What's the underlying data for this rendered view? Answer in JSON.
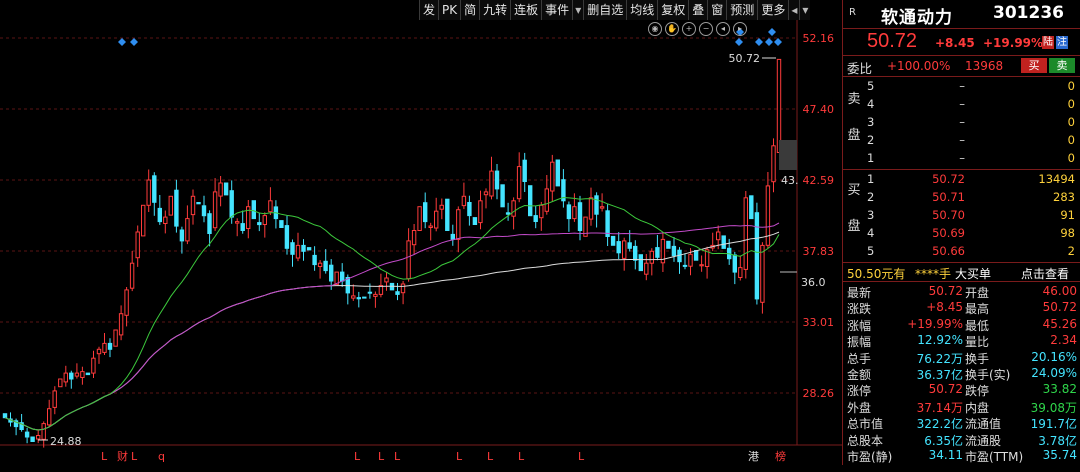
{
  "toolbar": {
    "items": [
      "发",
      "PK",
      "简",
      "九转",
      "连板",
      "事件",
      "▾",
      "删自选",
      "均线",
      "复权",
      "叠",
      "窗",
      "预测",
      "更多",
      "◂",
      "▾"
    ]
  },
  "chart": {
    "price_axis": [
      "52.16",
      "47.40",
      "42.59",
      "37.83",
      "33.01",
      "28.26"
    ],
    "high_label": "50.72",
    "low_label": "24.88",
    "right_tag_1": "43.",
    "right_tag_2": "36.0",
    "bottom_markers": [
      {
        "text": "L",
        "color": "#ff3b3b"
      },
      {
        "text": "财",
        "color": "#ff3b3b"
      },
      {
        "text": "L",
        "color": "#ff3b3b"
      },
      {
        "text": "q",
        "color": "#ff3b3b"
      },
      {
        "text": "L",
        "color": "#ff3b3b"
      },
      {
        "text": "L",
        "color": "#ff3b3b"
      },
      {
        "text": "L",
        "color": "#ff3b3b"
      },
      {
        "text": "L",
        "color": "#ff3b3b"
      },
      {
        "text": "L",
        "color": "#ff3b3b"
      },
      {
        "text": "L",
        "color": "#ff3b3b"
      },
      {
        "text": "L",
        "color": "#ff3b3b"
      },
      {
        "text": "港",
        "color": "#dddddd"
      },
      {
        "text": "榜",
        "color": "#ff3b3b"
      }
    ],
    "colors": {
      "up": "#ff3b3b",
      "down": "#44e4ff",
      "ma_green": "#3cc93c",
      "ma_purple": "#c24bc9",
      "ma_white": "#dcdcdc"
    }
  },
  "stock": {
    "badge": "R",
    "name": "软通动力",
    "code": "301236",
    "price": "50.72",
    "change": "+8.45",
    "change_pct": "+19.99%",
    "tag1": "陆",
    "tag2": "注"
  },
  "weibi": {
    "label": "委比",
    "pct": "+100.00%",
    "num": "13968",
    "buy": "买",
    "sell": "卖"
  },
  "sell_book": {
    "side_label": "卖盘",
    "levels": [
      {
        "lvl": "5",
        "price": "–",
        "vol": "0"
      },
      {
        "lvl": "4",
        "price": "–",
        "vol": "0"
      },
      {
        "lvl": "3",
        "price": "–",
        "vol": "0"
      },
      {
        "lvl": "2",
        "price": "–",
        "vol": "0"
      },
      {
        "lvl": "1",
        "price": "–",
        "vol": "0"
      }
    ]
  },
  "buy_book": {
    "side_label": "买盘",
    "levels": [
      {
        "lvl": "1",
        "price": "50.72",
        "vol": "13494"
      },
      {
        "lvl": "2",
        "price": "50.71",
        "vol": "283"
      },
      {
        "lvl": "3",
        "price": "50.70",
        "vol": "91"
      },
      {
        "lvl": "4",
        "price": "50.69",
        "vol": "98"
      },
      {
        "lvl": "5",
        "price": "50.66",
        "vol": "2"
      }
    ]
  },
  "bigorder": {
    "price": "50.50元有",
    "shares": "****手",
    "big": "大买单",
    "click": "点击查看"
  },
  "stats": [
    {
      "l1": "最新",
      "v1": "50.72",
      "c1": "red",
      "l2": "开盘",
      "v2": "46.00",
      "c2": "red"
    },
    {
      "l1": "涨跌",
      "v1": "+8.45",
      "c1": "red",
      "l2": "最高",
      "v2": "50.72",
      "c2": "red"
    },
    {
      "l1": "涨幅",
      "v1": "+19.99%",
      "c1": "red",
      "l2": "最低",
      "v2": "45.26",
      "c2": "red"
    },
    {
      "l1": "振幅",
      "v1": "12.92%",
      "c1": "cyan",
      "l2": "量比",
      "v2": "2.34",
      "c2": "red"
    },
    {
      "l1": "总手",
      "v1": "76.22万",
      "c1": "cyan",
      "l2": "换手",
      "v2": "20.16%",
      "c2": "cyan"
    },
    {
      "l1": "金额",
      "v1": "36.37亿",
      "c1": "cyan",
      "l2": "换手(实)",
      "v2": "24.09%",
      "c2": "cyan"
    },
    {
      "l1": "涨停",
      "v1": "50.72",
      "c1": "red",
      "l2": "跌停",
      "v2": "33.82",
      "c2": "green"
    },
    {
      "l1": "外盘",
      "v1": "37.14万",
      "c1": "red",
      "l2": "内盘",
      "v2": "39.08万",
      "c2": "green"
    },
    {
      "l1": "总市值",
      "v1": "322.2亿",
      "c1": "cyan",
      "l2": "流通值",
      "v2": "191.7亿",
      "c2": "cyan"
    },
    {
      "l1": "总股本",
      "v1": "6.35亿",
      "c1": "cyan",
      "l2": "流通股",
      "v2": "3.78亿",
      "c2": "cyan"
    },
    {
      "l1": "市盈(静)",
      "v1": "34.11",
      "c1": "cyan",
      "l2": "市盈(TTM)",
      "v2": "35.74",
      "c2": "cyan"
    }
  ]
}
